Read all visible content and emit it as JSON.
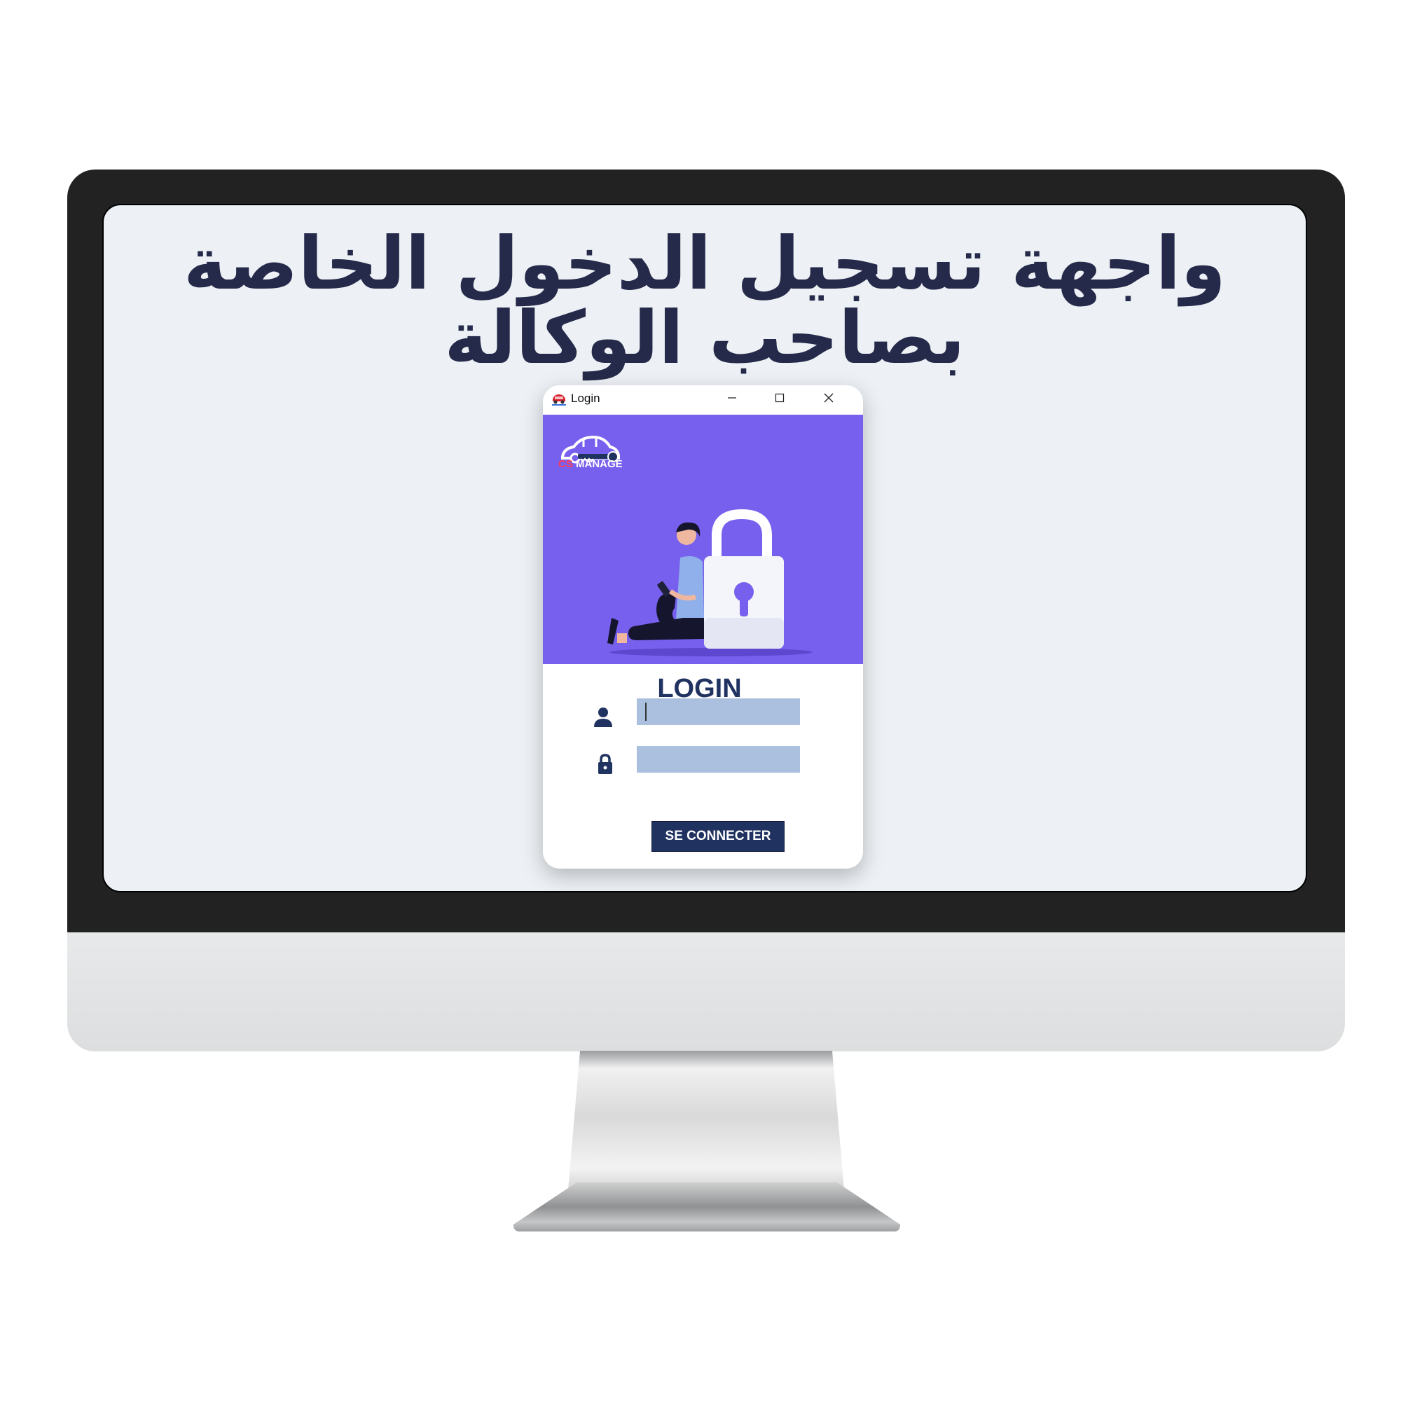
{
  "headline": {
    "line1": "واجهة تسجيل الدخول الخاصة",
    "line2": "بصاحب الوكالة"
  },
  "window": {
    "title": "Login",
    "controls": [
      "minimize-icon",
      "maximize-icon",
      "close-icon"
    ]
  },
  "brand": {
    "prefix": "CS",
    "name": "MANAGE"
  },
  "form": {
    "heading": "LOGIN",
    "username_value": "",
    "password_value": "",
    "submit_label": "SE CONNECTER"
  },
  "colors": {
    "hero": "#7860ee",
    "navy": "#1f3260",
    "field": "#abc0df",
    "brand_accent": "#ff3d5a",
    "screen_bg": "#edf1f5",
    "headline": "#262a4a"
  }
}
